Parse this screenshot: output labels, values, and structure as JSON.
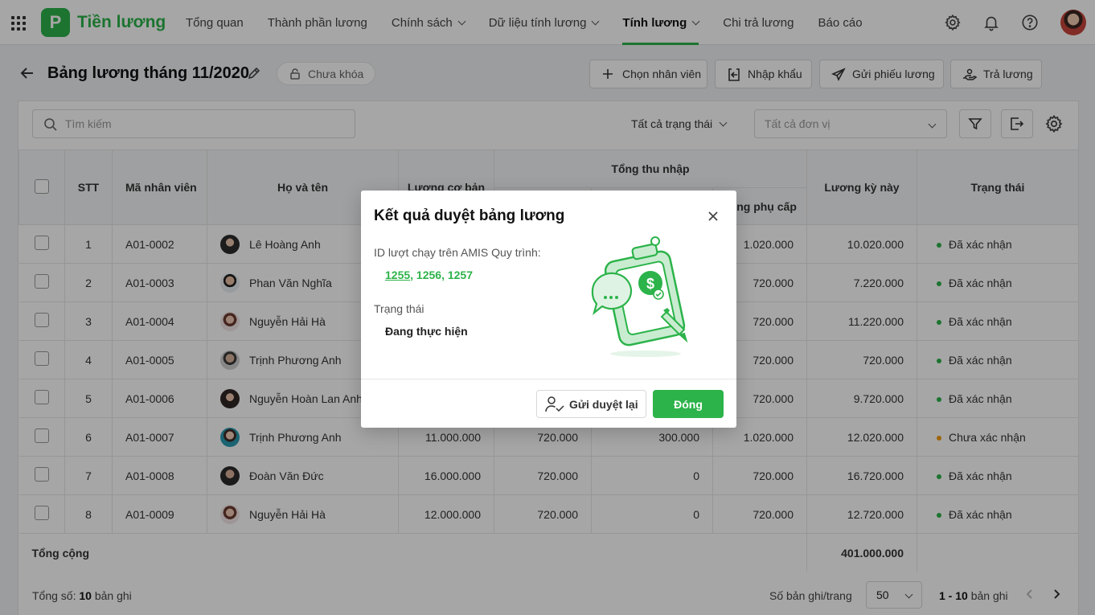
{
  "app": {
    "brand": "Tiền lương",
    "logo_letter": "P",
    "accent": "#2cb34a"
  },
  "nav": {
    "items": [
      {
        "label": "Tổng quan",
        "dropdown": false,
        "active": false
      },
      {
        "label": "Thành phần lương",
        "dropdown": false,
        "active": false
      },
      {
        "label": "Chính sách",
        "dropdown": true,
        "active": false
      },
      {
        "label": "Dữ liệu tính lương",
        "dropdown": true,
        "active": false
      },
      {
        "label": "Tính lương",
        "dropdown": true,
        "active": true
      },
      {
        "label": "Chi trả lương",
        "dropdown": false,
        "active": false
      },
      {
        "label": "Báo cáo",
        "dropdown": false,
        "active": false
      }
    ],
    "icons": [
      "settings-icon",
      "bell-icon",
      "help-icon",
      "avatar"
    ]
  },
  "page": {
    "title": "Bảng lương tháng 11/2020",
    "lock_status": "Chưa khóa",
    "actions": {
      "choose_employee": "Chọn nhân viên",
      "import": "Nhập khẩu",
      "send_payslip": "Gửi phiếu lương",
      "pay": "Trả lương"
    }
  },
  "toolbar": {
    "search_placeholder": "Tìm kiếm",
    "status_filter": "Tất cả trạng thái",
    "unit_placeholder": "Tất cả đơn vị"
  },
  "table": {
    "headers": {
      "stt": "STT",
      "code": "Mã nhân viên",
      "name": "Họ và tên",
      "base": "Lương cơ bản",
      "income_group": "Tổng thu nhập",
      "allowance": "Tổng phụ cấp",
      "net": "Lương kỳ này",
      "status": "Trạng thái"
    },
    "rows": [
      {
        "stt": "1",
        "code": "A01-0002",
        "name": "Lê Hoàng Anh",
        "base": "",
        "c1": "",
        "c2": "",
        "allowance": "1.020.000",
        "net": "10.020.000",
        "status": "Đã xác nhận",
        "state": "ok"
      },
      {
        "stt": "2",
        "code": "A01-0003",
        "name": "Phan Văn Nghĩa",
        "base": "",
        "c1": "",
        "c2": "",
        "allowance": "720.000",
        "net": "7.220.000",
        "status": "Đã xác nhận",
        "state": "ok"
      },
      {
        "stt": "3",
        "code": "A01-0004",
        "name": "Nguyễn Hải Hà",
        "base": "",
        "c1": "",
        "c2": "",
        "allowance": "720.000",
        "net": "11.220.000",
        "status": "Đã xác nhận",
        "state": "ok"
      },
      {
        "stt": "4",
        "code": "A01-0005",
        "name": "Trịnh Phương Anh",
        "base": "",
        "c1": "",
        "c2": "",
        "allowance": "720.000",
        "net": "720.000",
        "status": "Đã xác nhận",
        "state": "ok"
      },
      {
        "stt": "5",
        "code": "A01-0006",
        "name": "Nguyễn Hoàn Lan Anh",
        "base": "",
        "c1": "",
        "c2": "",
        "allowance": "720.000",
        "net": "9.720.000",
        "status": "Đã xác nhận",
        "state": "ok"
      },
      {
        "stt": "6",
        "code": "A01-0007",
        "name": "Trịnh Phương Anh",
        "base": "11.000.000",
        "c1": "720.000",
        "c2": "300.000",
        "allowance": "1.020.000",
        "net": "12.020.000",
        "status": "Chưa xác nhận",
        "state": "pending"
      },
      {
        "stt": "7",
        "code": "A01-0008",
        "name": "Đoàn Văn Đức",
        "base": "16.000.000",
        "c1": "720.000",
        "c2": "0",
        "allowance": "720.000",
        "net": "16.720.000",
        "status": "Đã xác nhận",
        "state": "ok"
      },
      {
        "stt": "8",
        "code": "A01-0009",
        "name": "Nguyễn Hải Hà",
        "base": "12.000.000",
        "c1": "720.000",
        "c2": "0",
        "allowance": "720.000",
        "net": "12.720.000",
        "status": "Đã xác nhận",
        "state": "ok"
      }
    ],
    "total_label": "Tổng cộng",
    "total_value": "401.000.000"
  },
  "footer": {
    "total_prefix": "Tổng số: ",
    "total_count": "10",
    "total_suffix": " bản ghi",
    "per_page_label": "Số bản ghi/trang",
    "per_page": "50",
    "range": "1 - 10",
    "range_suffix": " bản ghi"
  },
  "modal": {
    "title": "Kết quả duyệt bảng lương",
    "id_label": "ID lượt chạy trên AMIS Quy trình:",
    "id_first": "1255",
    "id_rest": ", 1256, 1257",
    "status_label": "Trạng thái",
    "status_value": "Đang thực hiện",
    "resend_label": "Gửi duyệt lại",
    "close_label": "Đóng"
  }
}
